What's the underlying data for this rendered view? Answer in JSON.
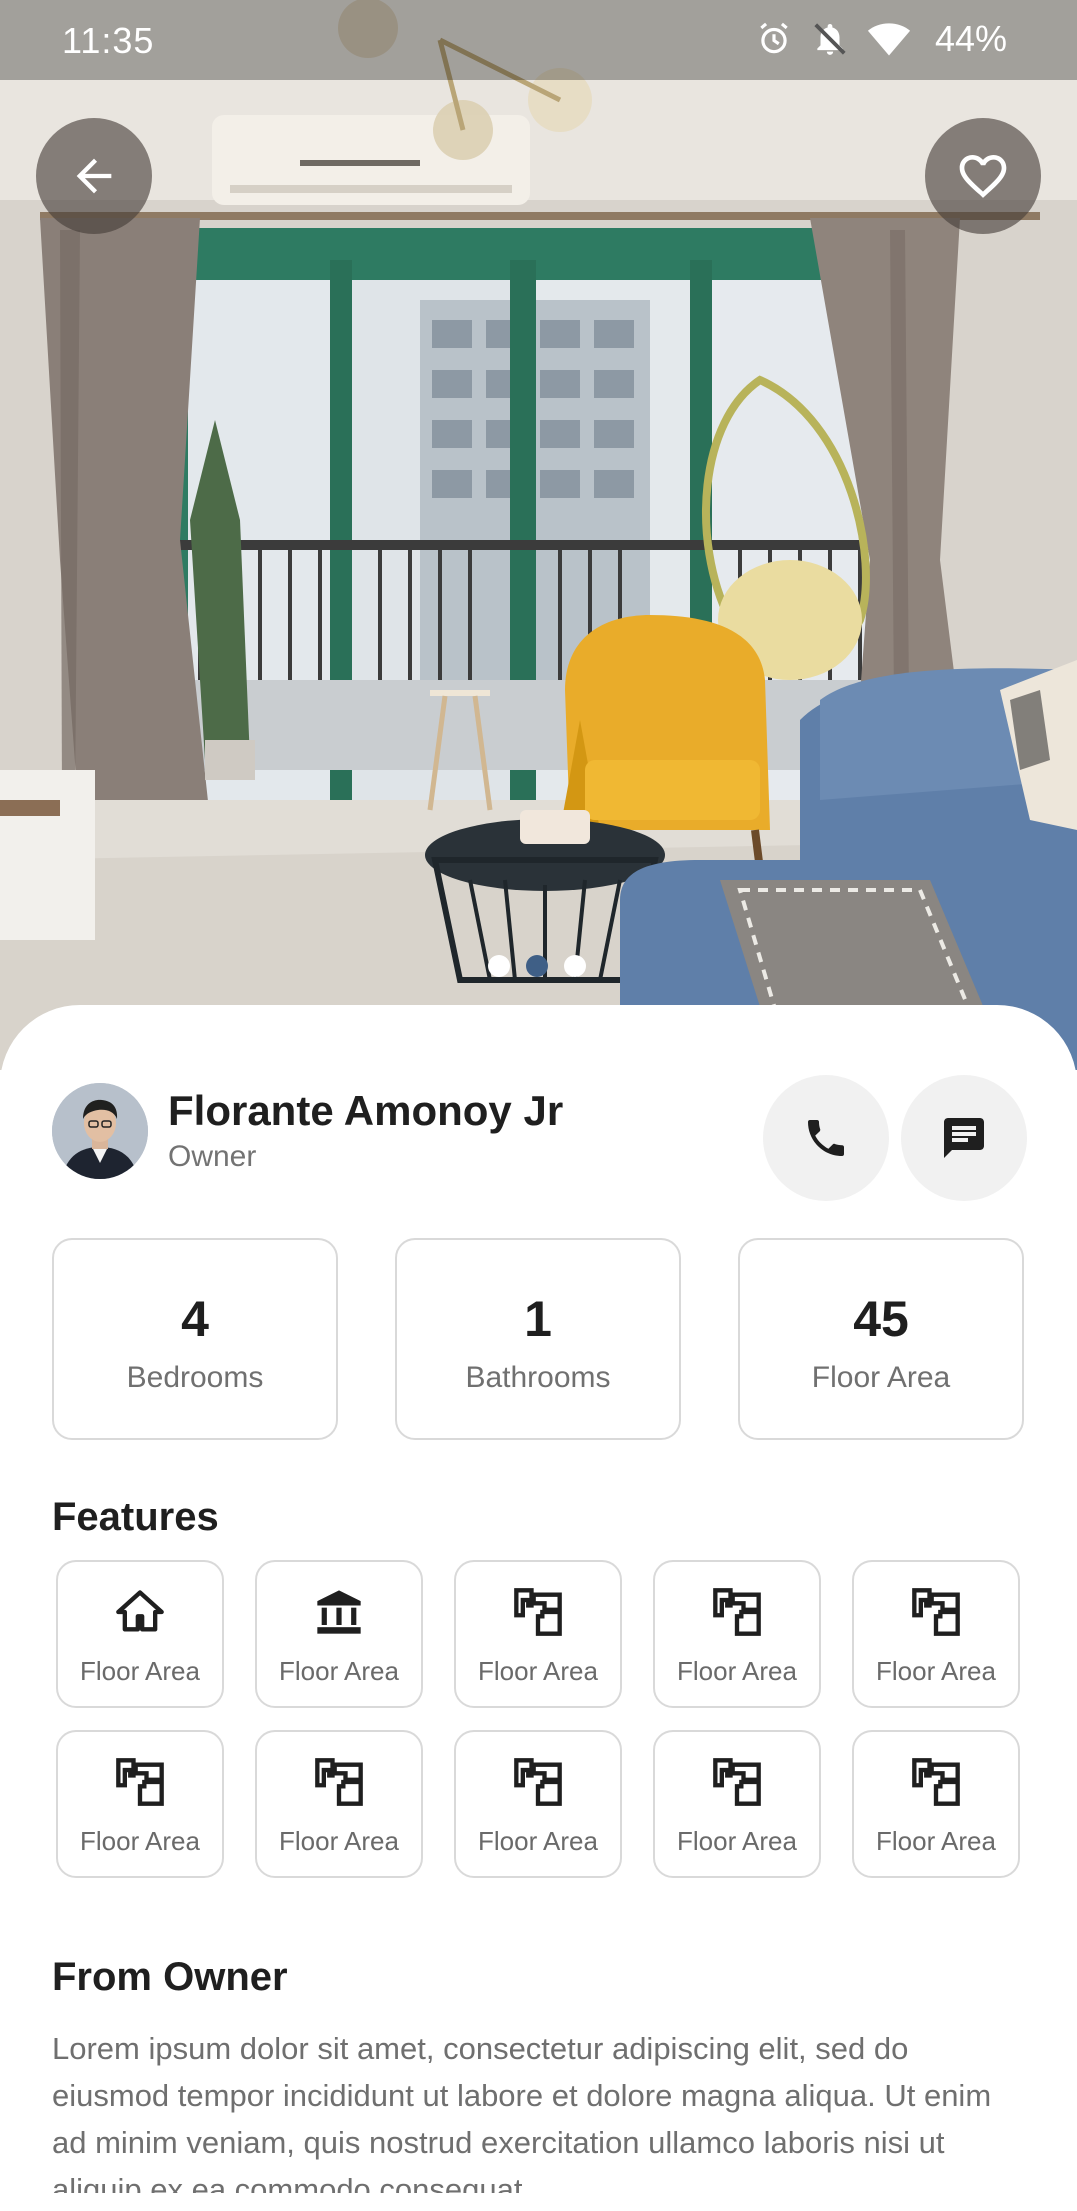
{
  "status_bar": {
    "time": "11:35",
    "battery": "44%"
  },
  "hero": {
    "image_subject": "living room with yellow armchair, blue sofa and balcony glass doors",
    "slide_count": 3,
    "active_slide": 2
  },
  "owner": {
    "name": "Florante Amonoy Jr",
    "role": "Owner"
  },
  "stats": [
    {
      "value": "4",
      "label": "Bedrooms"
    },
    {
      "value": "1",
      "label": "Bathrooms"
    },
    {
      "value": "45",
      "label": "Floor Area"
    }
  ],
  "features_title": "Features",
  "features": [
    {
      "icon": "house-icon",
      "label": "Floor Area"
    },
    {
      "icon": "bank-icon",
      "label": "Floor Area"
    },
    {
      "icon": "floor-plan-icon",
      "label": "Floor Area"
    },
    {
      "icon": "floor-plan-icon",
      "label": "Floor Area"
    },
    {
      "icon": "floor-plan-icon",
      "label": "Floor Area"
    },
    {
      "icon": "floor-plan-icon",
      "label": "Floor Area"
    },
    {
      "icon": "floor-plan-icon",
      "label": "Floor Area"
    },
    {
      "icon": "floor-plan-icon",
      "label": "Floor Area"
    },
    {
      "icon": "floor-plan-icon",
      "label": "Floor Area"
    },
    {
      "icon": "floor-plan-icon",
      "label": "Floor Area"
    }
  ],
  "from_owner_title": "From Owner",
  "description": "Lorem ipsum dolor sit amet, consectetur adipiscing elit, sed do eiusmod tempor incididunt ut labore et dolore magna aliqua. Ut enim ad minim veniam, quis nostrud exercitation ullamco laboris nisi ut aliquip ex ea commodo consequat.",
  "colors": {
    "accent_dot": "#3f5f86",
    "card_border": "#d9d9d9",
    "button_bg": "#f1f1f1"
  }
}
